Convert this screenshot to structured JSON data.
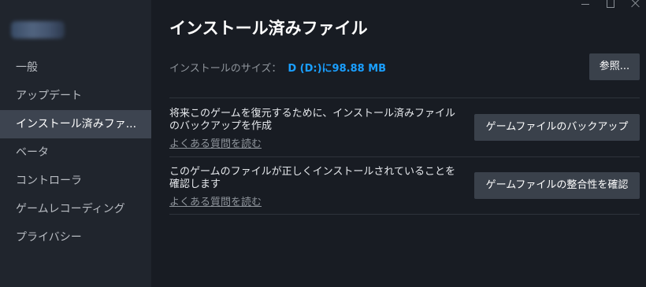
{
  "window": {
    "controls": [
      "minimize",
      "maximize",
      "close"
    ]
  },
  "sidebar": {
    "items": [
      {
        "label": "一般"
      },
      {
        "label": "アップデート"
      },
      {
        "label": "インストール済みファ..."
      },
      {
        "label": "ベータ"
      },
      {
        "label": "コントローラ"
      },
      {
        "label": "ゲームレコーディング"
      },
      {
        "label": "プライバシー"
      }
    ],
    "active_index": 2
  },
  "main": {
    "title": "インストール済みファイル",
    "install_size": {
      "label": "インストールのサイズ：",
      "value": "D (D:)に98.88 MB"
    },
    "browse_button": "参照...",
    "sections": [
      {
        "description": "将来このゲームを復元するために、インストール済みファイルのバックアップを作成",
        "faq_link": "よくある質問を読む",
        "button": "ゲームファイルのバックアップ"
      },
      {
        "description": "このゲームのファイルが正しくインストールされていることを確認します",
        "faq_link": "よくある質問を読む",
        "button": "ゲームファイルの整合性を確認"
      }
    ]
  },
  "colors": {
    "background": "#181c23",
    "sidebar": "#20252d",
    "active_item": "#3d4450",
    "accent": "#1a9fff",
    "button": "#3a414b"
  }
}
